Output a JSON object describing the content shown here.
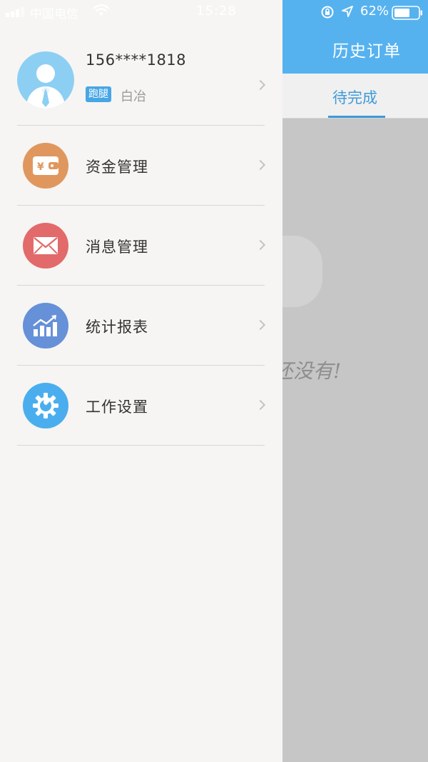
{
  "status_bar": {
    "carrier": "中国电信",
    "time": "15:28",
    "battery": "62%"
  },
  "background": {
    "header_title": "历史订单",
    "tab_label": "待完成",
    "empty_text": "还没有!",
    "header_color": "#56b2ef",
    "tab_accent_color": "#3f9ad9"
  },
  "drawer": {
    "profile": {
      "phone": "156****1818",
      "role_badge": "跑腿",
      "name": "白冶"
    },
    "menu": [
      {
        "label": "资金管理",
        "icon": "wallet-icon",
        "color": "#e0975e"
      },
      {
        "label": "消息管理",
        "icon": "envelope-icon",
        "color": "#e36a6a"
      },
      {
        "label": "统计报表",
        "icon": "chart-icon",
        "color": "#6691d8"
      },
      {
        "label": "工作设置",
        "icon": "gear-wrench-icon",
        "color": "#4aaeee"
      }
    ]
  }
}
